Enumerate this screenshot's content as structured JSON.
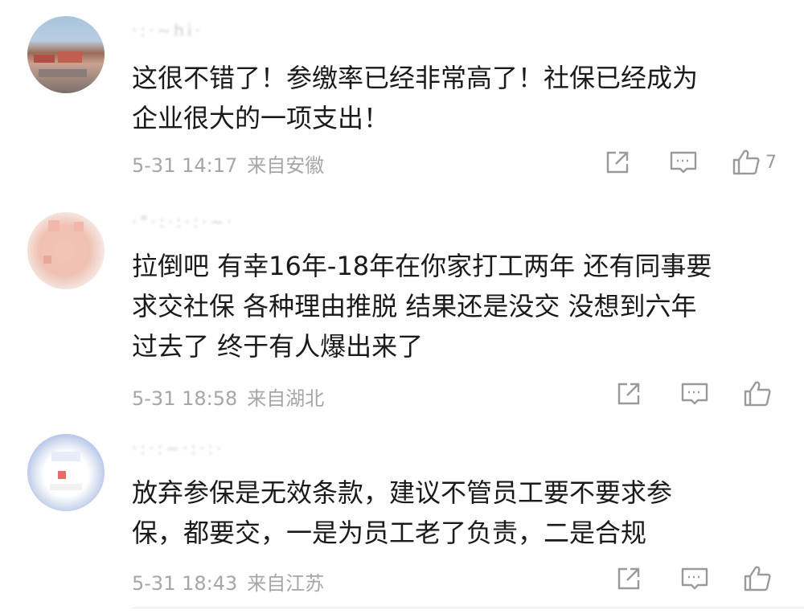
{
  "comments": [
    {
      "username": "·:·~hi·",
      "text": "这很不错了！参缴率已经非常高了！社保已经成为\n企业很大的一项支出！",
      "time": "5-31 14:17",
      "location": "来自安徽",
      "likes": "7",
      "avatar_color": "#b38a78"
    },
    {
      "username": "·\"·:·:·:·~·",
      "text": "拉倒吧 有幸16年-18年在你家打工两年 还有同事要\n求交社保 各种理由推脱 结果还是没交 没想到六年\n过去了 终于有人爆出来了",
      "time": "5-31 18:58",
      "location": "来自湖北",
      "likes": "",
      "avatar_color": "#f0c0b2"
    },
    {
      "username": "·:·:~·:·:·",
      "text": "放弃参保是无效条款，建议不管员工要不要求参\n保，都要交，一是为员工老了负责，二是合规",
      "time": "5-31 18:43",
      "location": "来自江苏",
      "likes": "",
      "avatar_color": "#a8bde8"
    }
  ],
  "icons": {
    "share": "share-icon",
    "reply": "comment-icon",
    "like": "thumbs-up-icon"
  }
}
